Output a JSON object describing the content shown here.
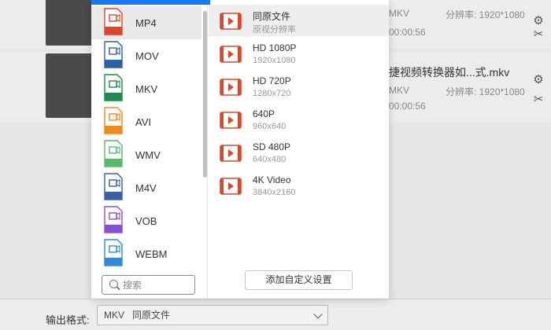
{
  "background_rows": [
    {
      "meta1": "MKV",
      "meta2": "分辨率: 1920*1080",
      "time": "00:00:56"
    },
    {
      "name": "捷视频转换器如...式.mkv",
      "meta1": "MKV",
      "meta2": "分辨率: 1920*1080",
      "time": "00:00:56"
    }
  ],
  "output": {
    "label": "输出格式:",
    "format": "MKV",
    "preset": "同原文件"
  },
  "formats": [
    {
      "label": "MP4",
      "color": "#d9482b"
    },
    {
      "label": "MOV",
      "color": "#2f5fa8"
    },
    {
      "label": "MKV",
      "color": "#1f8a4c"
    },
    {
      "label": "AVI",
      "color": "#f08a1c"
    },
    {
      "label": "WMV",
      "color": "#5bb86a"
    },
    {
      "label": "M4V",
      "color": "#3b5ea8"
    },
    {
      "label": "VOB",
      "color": "#8a4fd1"
    },
    {
      "label": "WEBM",
      "color": "#2e8ad8"
    }
  ],
  "resolutions": [
    {
      "name": "同原文件",
      "sub": "原视分辨率"
    },
    {
      "name": "HD 1080P",
      "sub": "1920x1080"
    },
    {
      "name": "HD 720P",
      "sub": "1280x720"
    },
    {
      "name": "640P",
      "sub": "960x640"
    },
    {
      "name": "SD 480P",
      "sub": "640x480"
    },
    {
      "name": "4K Video",
      "sub": "3840x2160"
    }
  ],
  "search": {
    "placeholder": "搜索"
  },
  "add_custom": "添加自定义设置",
  "colors": {
    "accent": "#1677ff",
    "video_icon_red": "#d9482b"
  }
}
